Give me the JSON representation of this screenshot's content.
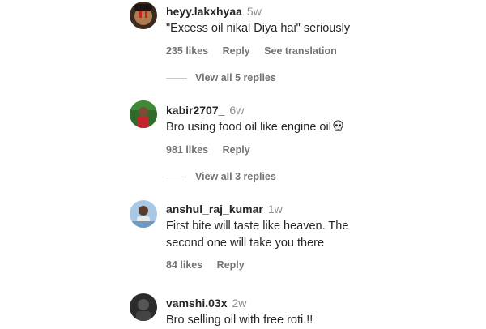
{
  "comments": [
    {
      "username": "heyy.lakxhyaa",
      "time": "5w",
      "text": "\"Excess oil nikal Diya hai\" seriously",
      "likes": "235 likes",
      "reply": "Reply",
      "translation": "See translation",
      "view_replies": "View all 5 replies"
    },
    {
      "username": "kabir2707_",
      "time": "6w",
      "text": "Bro using food oil like engine oil",
      "emoji": "skull-emoji",
      "likes": "981 likes",
      "reply": "Reply",
      "view_replies": "View all 3 replies"
    },
    {
      "username": "anshul_raj_kumar",
      "time": "1w",
      "text_line1": "First bite will taste like heaven. The",
      "text_line2": "second one will take you there",
      "likes": "84 likes",
      "reply": "Reply"
    },
    {
      "username": "vamshi.03x",
      "time": "2w",
      "text": "Bro selling oil with free roti.!!"
    }
  ],
  "colors": {
    "primary_text": "#262626",
    "secondary_text": "#737373",
    "divider": "#c7c7c7"
  }
}
